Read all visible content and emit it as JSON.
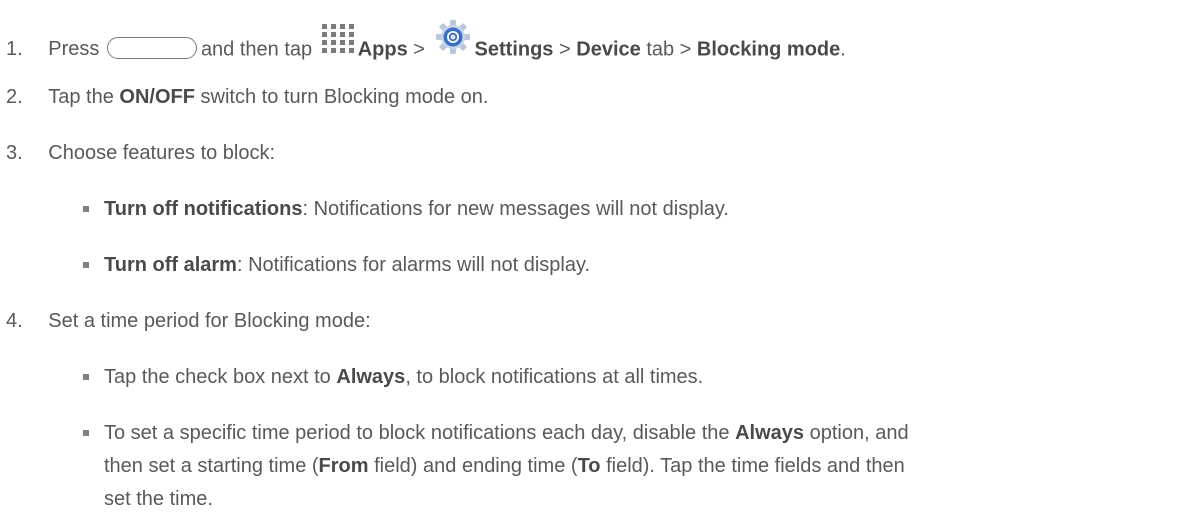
{
  "steps": {
    "s1": {
      "num": "1.",
      "press": "Press",
      "and_tap": "and then tap",
      "apps": "Apps",
      "sep1": ">",
      "settings": "Settings",
      "sep2": ">",
      "device": "Device",
      "tab": "tab >",
      "blocking_mode": "Blocking mode",
      "end": "."
    },
    "s2": {
      "num": "2.",
      "pre": "Tap the",
      "switch": "ON/OFF",
      "post": "switch to turn Blocking mode on."
    },
    "s3": {
      "num": "3.",
      "text": "Choose features to block:",
      "b1_bold": "Turn off notifications",
      "b1_text": ": Notifications for new messages will not display.",
      "b2_bold": "Turn off alarm",
      "b2_text": ": Notifications for alarms will not display."
    },
    "s4": {
      "num": "4.",
      "text": "Set a time period for Blocking mode:",
      "b1_pre": "Tap the check box next to",
      "b1_bold": "Always",
      "b1_post": ", to block notifications at all times.",
      "b2_l1_pre": "To set a specific time period to block notifications each day, disable the",
      "b2_l1_bold": "Always",
      "b2_l1_post": "option, and",
      "b2_l2_pre": "then set a starting time (",
      "b2_l2_from": "From",
      "b2_l2_mid": "field) and ending time (",
      "b2_l2_to": "To",
      "b2_l2_post": "field). Tap the time fields and then",
      "b2_l3": "set the time."
    }
  },
  "icons": {
    "home": "home-button-icon",
    "apps": "apps-grid-icon",
    "settings": "settings-gear-icon"
  },
  "colors": {
    "text": "#595959",
    "bold": "#4a4a4a",
    "gear_blue": "#3a6fc4"
  }
}
